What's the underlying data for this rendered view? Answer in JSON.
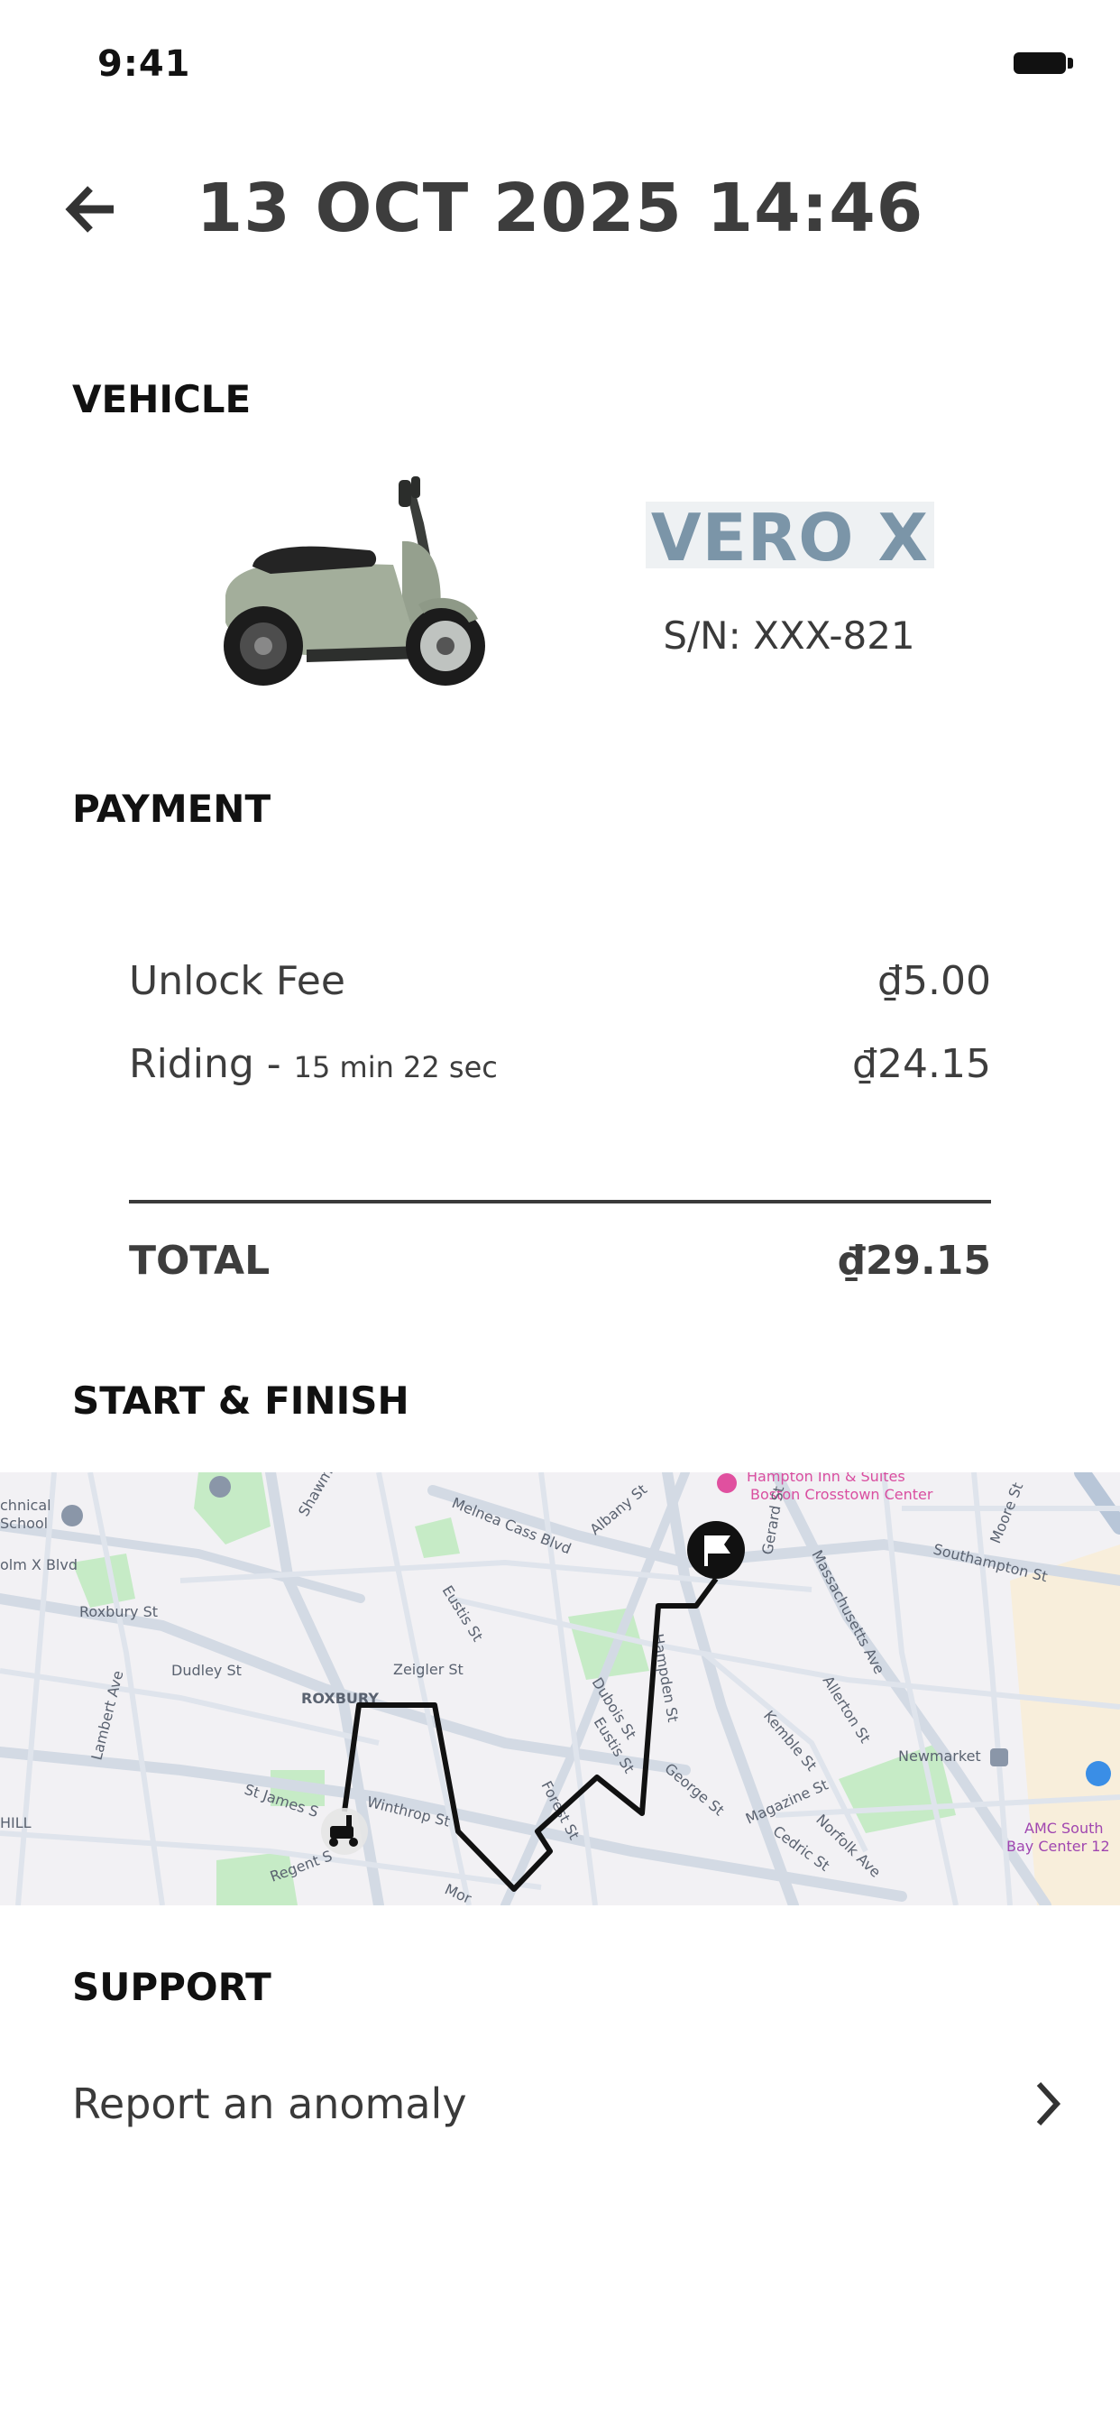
{
  "status_bar": {
    "time": "9:41"
  },
  "header": {
    "title": "13 OCT 2025 14:46"
  },
  "vehicle": {
    "section_label": "VEHICLE",
    "model_name": "VERO X",
    "serial": "S/N: XXX-821"
  },
  "payment": {
    "section_label": "PAYMENT",
    "unlock_label": "Unlock Fee",
    "unlock_amount": "₫5.00",
    "riding_label": "Riding - ",
    "riding_duration": "15 min 22 sec",
    "riding_amount": "₫24.15",
    "total_label": "TOTAL",
    "total_amount": "₫29.15"
  },
  "route": {
    "section_label": "START & FINISH",
    "map_labels": {
      "hotel_1": "Hampton Inn & Suites",
      "hotel_2": "Boston Crosstown Center",
      "school_1": "chnical",
      "school_2": "School",
      "malcolm": "olm X Blvd",
      "shawmut": "Shawmut",
      "melnea": "Melnea Cass Blvd",
      "albany": "Albany St",
      "gerard": "Gerard St",
      "mass_ave": "Massachusetts Ave",
      "southampton": "Southampton St",
      "moore": "Moore St",
      "roxbury_st": "Roxbury St",
      "eustis_1": "Eustis St",
      "dudley": "Dudley St",
      "zeigler": "Zeigler St",
      "roxbury": "ROXBURY",
      "dubois": "Dubois St",
      "eustis_2": "Eustis St",
      "hampden": "Hampden St",
      "allerton": "Allerton St",
      "lambert": "Lambert Ave",
      "kemble": "Kemble St",
      "newmarket": "Newmarket",
      "st_james": "St James S",
      "winthrop": "Winthrop St",
      "forest": "Forest St",
      "george": "George St",
      "magazine": "Magazine St",
      "cedric": "Cedric St",
      "norfolk": "Norfolk Ave",
      "hill": "HILL",
      "regent": "Regent S",
      "mor": "Mor",
      "amc_1": "AMC South",
      "amc_2": "Bay Center 12"
    }
  },
  "support": {
    "section_label": "SUPPORT",
    "report_label": "Report an anomaly"
  },
  "colors": {
    "accent_model": "#7b95a8",
    "text_dark": "#3a3a3a",
    "route_line": "#111111",
    "map_background": "#f2f1f4",
    "map_park": "#c6ebc6",
    "map_road": "#d3dae4"
  }
}
